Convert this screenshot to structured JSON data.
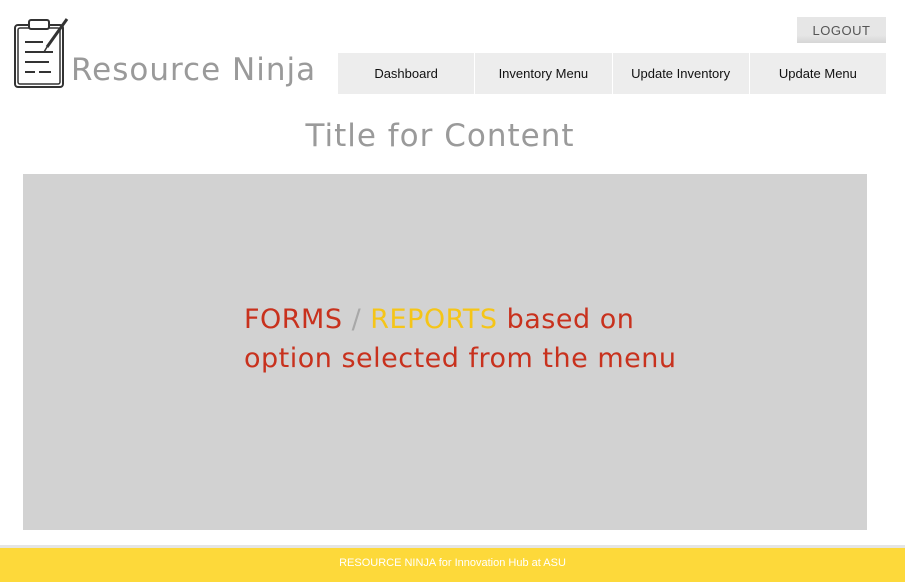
{
  "header": {
    "brand": "Resource Ninja",
    "logo_icon": "clipboard-pencil-icon",
    "logout_label": "LOGOUT"
  },
  "nav": {
    "items": [
      {
        "label": "Dashboard"
      },
      {
        "label": "Inventory Menu"
      },
      {
        "label": "Update Inventory"
      },
      {
        "label": "Update Menu"
      }
    ]
  },
  "main": {
    "title": "Title for Content",
    "panel": {
      "forms": "FORMS",
      "slash": " / ",
      "reports": "REPORTS",
      "line1_rest": " based on",
      "line2": "option selected from the menu"
    }
  },
  "footer": {
    "text": "RESOURCE NINJA for Innovation Hub at ASU"
  },
  "colors": {
    "accent_red": "#c8311d",
    "accent_yellow": "#f5c518",
    "footer_bg": "#fdd93a",
    "panel_bg": "#d2d2d2",
    "nav_bg": "#ededed"
  }
}
